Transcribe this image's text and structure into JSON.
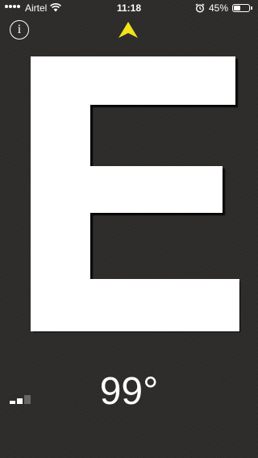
{
  "status_bar": {
    "carrier": "Airtel",
    "time": "11:18",
    "battery_percent": "45%",
    "battery_level": 0.45,
    "signal_bars": 4,
    "icons": [
      "signal-icon",
      "wifi-icon",
      "alarm-icon",
      "battery-icon"
    ]
  },
  "toolbar": {
    "info_label": "i",
    "info_icon": "info-icon"
  },
  "compass": {
    "heading_letter": "E",
    "degrees": "99°",
    "north_arrow_icon": "north-arrow-icon",
    "north_arrow_color": "#f4e21c",
    "accuracy_icon": "accuracy-bars-icon",
    "accuracy_level": 2,
    "accuracy_max": 3
  },
  "colors": {
    "background": "#2d2c2a",
    "letter": "#ffffff",
    "letter_shadow": "#000000",
    "accent": "#f4e21c"
  }
}
